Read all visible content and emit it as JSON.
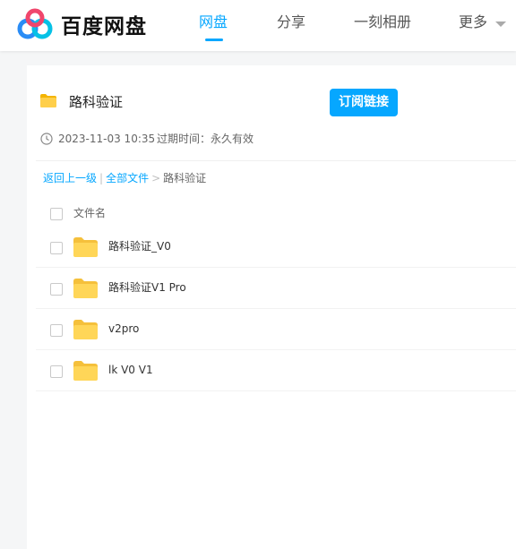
{
  "header": {
    "logo_text": "百度网盘",
    "nav": [
      {
        "label": "网盘",
        "active": true
      },
      {
        "label": "分享",
        "active": false
      },
      {
        "label": "一刻相册",
        "active": false
      },
      {
        "label": "更多",
        "active": false
      }
    ],
    "accent_color": "#06a7ff"
  },
  "share": {
    "title": "路科验证",
    "subscribe_label": "订阅链接",
    "date": "2023-11-03 10:35",
    "expire": "过期时间：永久有效"
  },
  "breadcrumb": {
    "back": "返回上一级",
    "sep1": "|",
    "all_files": "全部文件",
    "sep2": ">",
    "current": "路科验证"
  },
  "table": {
    "header_label": "文件名",
    "rows": [
      {
        "name": "路科验证_V0"
      },
      {
        "name": "路科验证V1 Pro"
      },
      {
        "name": "v2pro"
      },
      {
        "name": "lk V0 V1"
      }
    ]
  },
  "icons": {
    "logo": "baidu-cloud-logo-icon",
    "folder": "folder-icon",
    "clock": "clock-icon",
    "caret": "caret-down-icon"
  }
}
